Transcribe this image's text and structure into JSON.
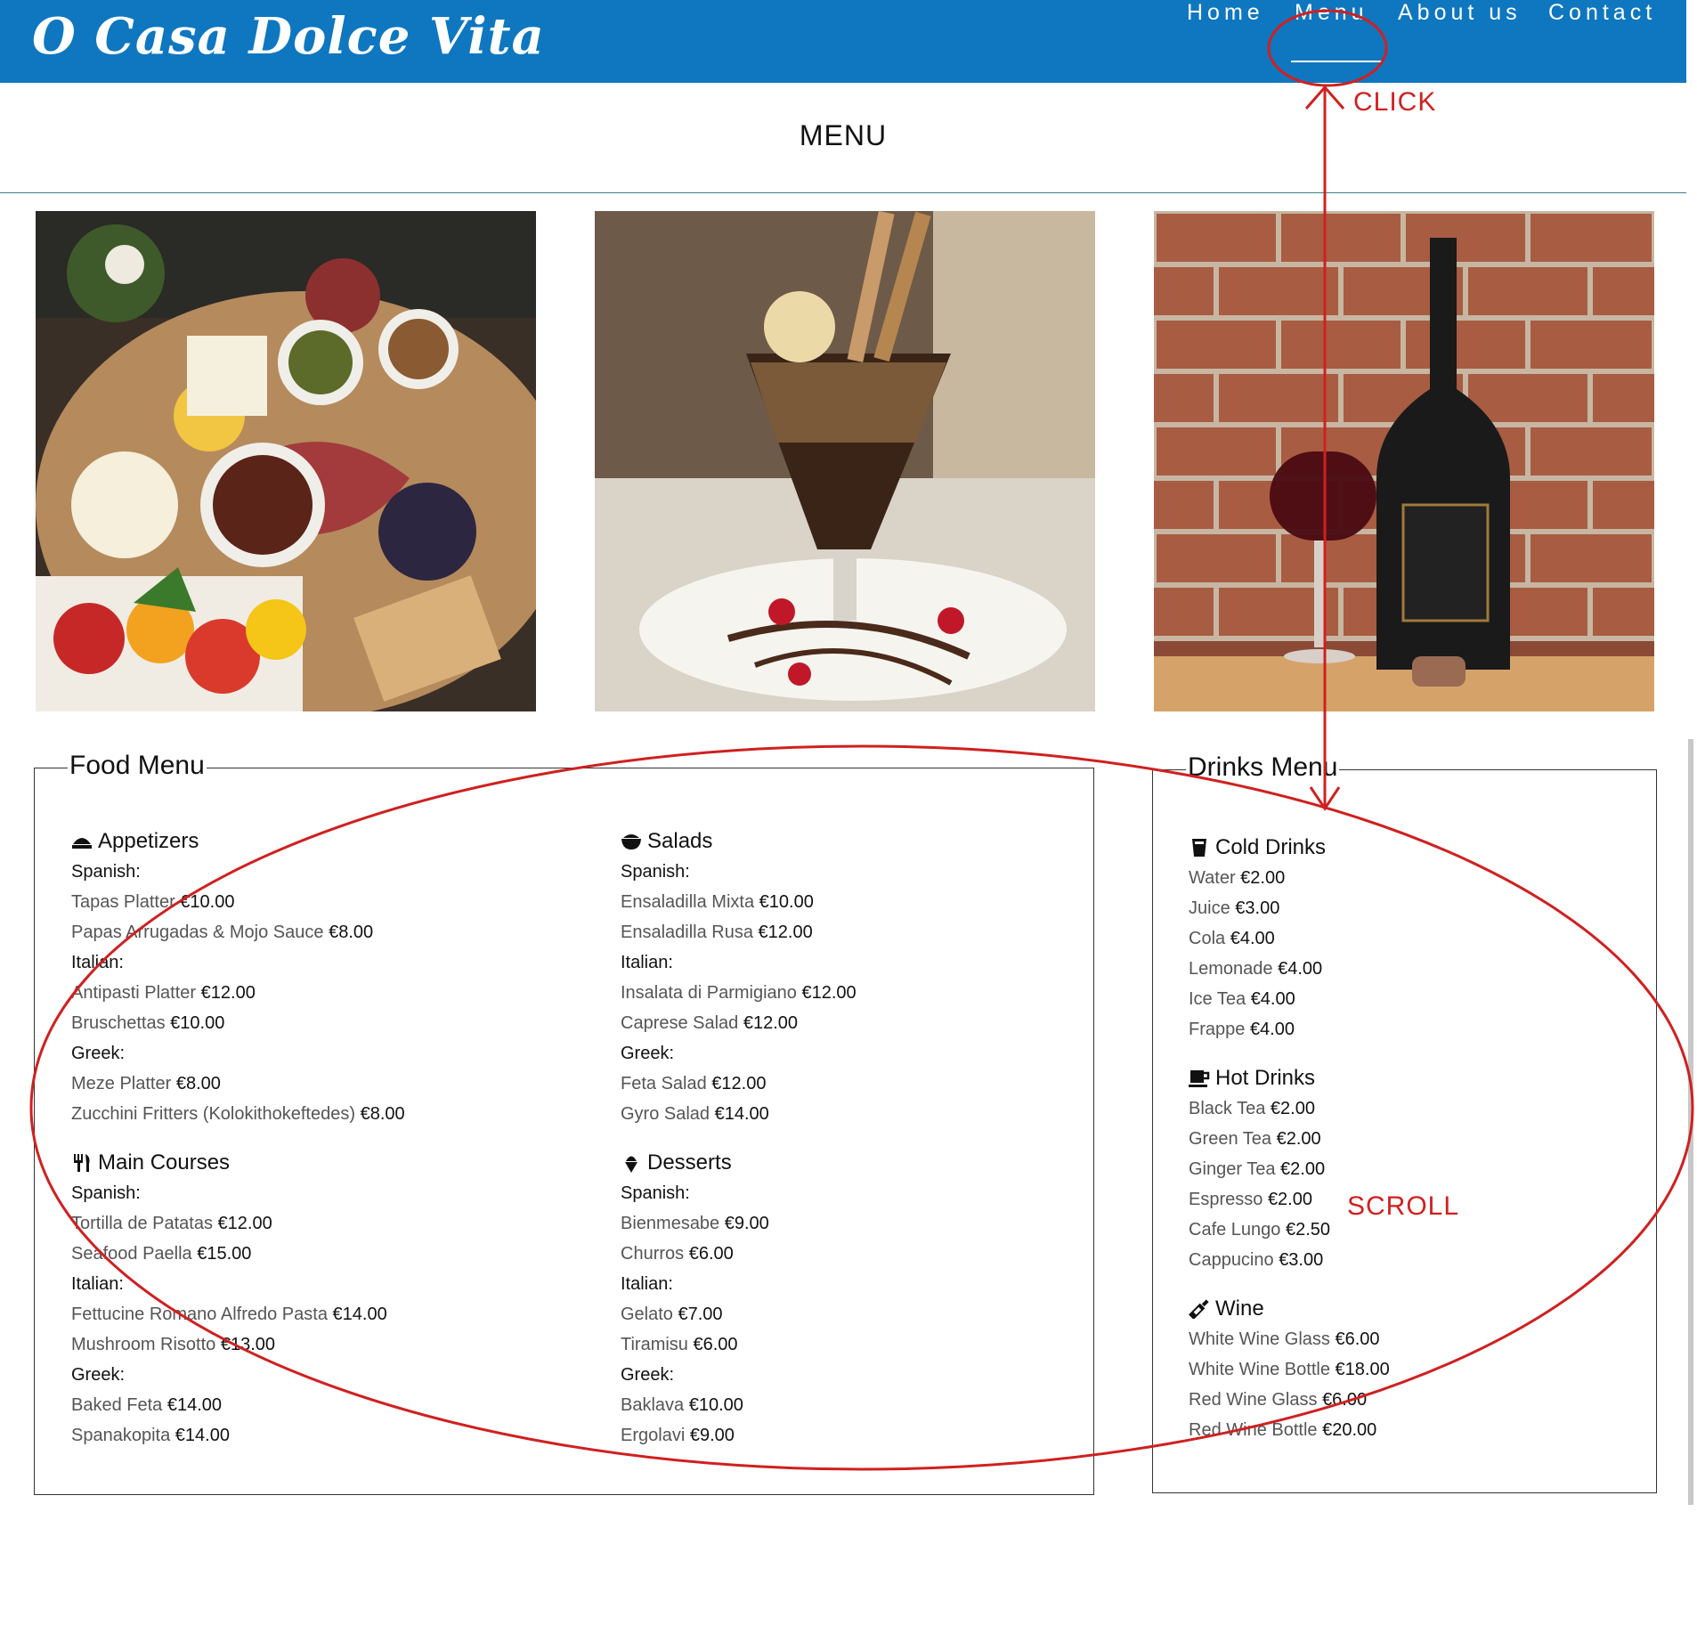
{
  "header": {
    "logo": "O Casa Dolce Vita",
    "nav": [
      {
        "label": "Home"
      },
      {
        "label": "Menu"
      },
      {
        "label": "About us"
      },
      {
        "label": "Contact"
      }
    ],
    "brand_color": "#0e77c0"
  },
  "page_title": "MENU",
  "photos": [
    {
      "icon": "antipasti-platter-photo"
    },
    {
      "icon": "ice-cream-sundae-photo"
    },
    {
      "icon": "red-wine-bottle-photo"
    }
  ],
  "food_menu": {
    "title": "Food Menu",
    "categories": [
      {
        "name": "Appetizers",
        "icon": "plate-icon",
        "lines": [
          {
            "region": "Spanish:"
          },
          {
            "item": "Tapas Platter",
            "price": "€10.00"
          },
          {
            "item": "Papas Arrugadas & Mojo Sauce",
            "price": "€8.00"
          },
          {
            "region": "Italian:"
          },
          {
            "item": "Antipasti Platter",
            "price": "€12.00"
          },
          {
            "item": "Bruschettas",
            "price": "€10.00"
          },
          {
            "region": "Greek:"
          },
          {
            "item": "Meze Platter",
            "price": "€8.00"
          },
          {
            "item": "Zucchini Fritters (Kolokithokeftedes)",
            "price": "€8.00"
          }
        ]
      },
      {
        "name": "Salads",
        "icon": "bowl-icon",
        "lines": [
          {
            "region": "Spanish:"
          },
          {
            "item": "Ensaladilla Mixta",
            "price": "€10.00"
          },
          {
            "item": "Ensaladilla Rusa",
            "price": "€12.00"
          },
          {
            "region": "Italian:"
          },
          {
            "item": "Insalata di Parmigiano",
            "price": "€12.00"
          },
          {
            "item": "Caprese Salad",
            "price": "€12.00"
          },
          {
            "region": "Greek:"
          },
          {
            "item": "Feta Salad",
            "price": "€12.00"
          },
          {
            "item": "Gyro Salad",
            "price": "€14.00"
          }
        ]
      },
      {
        "name": "Main Courses",
        "icon": "fork-knife-icon",
        "lines": [
          {
            "region": "Spanish:"
          },
          {
            "item": "Tortilla de Patatas",
            "price": "€12.00"
          },
          {
            "item": "Seafood Paella",
            "price": "€15.00"
          },
          {
            "region": "Italian:"
          },
          {
            "item": "Fettucine Romano Alfredo Pasta",
            "price": "€14.00"
          },
          {
            "item": "Mushroom Risotto",
            "price": "€13.00"
          },
          {
            "region": "Greek:"
          },
          {
            "item": "Baked Feta",
            "price": "€14.00"
          },
          {
            "item": "Spanakopita",
            "price": "€14.00"
          }
        ]
      },
      {
        "name": "Desserts",
        "icon": "ice-cream-icon",
        "lines": [
          {
            "region": "Spanish:"
          },
          {
            "item": "Bienmesabe",
            "price": "€9.00"
          },
          {
            "item": "Churros",
            "price": "€6.00"
          },
          {
            "region": "Italian:"
          },
          {
            "item": "Gelato",
            "price": "€7.00"
          },
          {
            "item": "Tiramisu",
            "price": "€6.00"
          },
          {
            "region": "Greek:"
          },
          {
            "item": "Baklava",
            "price": "€10.00"
          },
          {
            "item": "Ergolavi",
            "price": "€9.00"
          }
        ]
      }
    ]
  },
  "drinks_menu": {
    "title": "Drinks Menu",
    "categories": [
      {
        "name": "Cold Drinks",
        "icon": "glass-icon",
        "lines": [
          {
            "item": "Water",
            "price": "€2.00"
          },
          {
            "item": "Juice",
            "price": "€3.00"
          },
          {
            "item": "Cola",
            "price": "€4.00"
          },
          {
            "item": "Lemonade",
            "price": "€4.00"
          },
          {
            "item": "Ice Tea",
            "price": "€4.00"
          },
          {
            "item": "Frappe",
            "price": "€4.00"
          }
        ]
      },
      {
        "name": "Hot Drinks",
        "icon": "mug-icon",
        "lines": [
          {
            "item": "Black Tea",
            "price": "€2.00"
          },
          {
            "item": "Green Tea",
            "price": "€2.00"
          },
          {
            "item": "Ginger Tea",
            "price": "€2.00"
          },
          {
            "item": "Espresso",
            "price": "€2.00"
          },
          {
            "item": "Cafe Lungo",
            "price": "€2.50"
          },
          {
            "item": "Cappucino",
            "price": "€3.00"
          }
        ]
      },
      {
        "name": "Wine",
        "icon": "wine-bottle-icon",
        "lines": [
          {
            "item": "White Wine Glass",
            "price": "€6.00"
          },
          {
            "item": "White Wine Bottle",
            "price": "€18.00"
          },
          {
            "item": "Red Wine Glass",
            "price": "€6.00"
          },
          {
            "item": "Red Wine Bottle",
            "price": "€20.00"
          }
        ]
      }
    ]
  },
  "annotations": {
    "click_label": "CLICK",
    "scroll_label": "SCROLL",
    "color": "#d02020"
  }
}
